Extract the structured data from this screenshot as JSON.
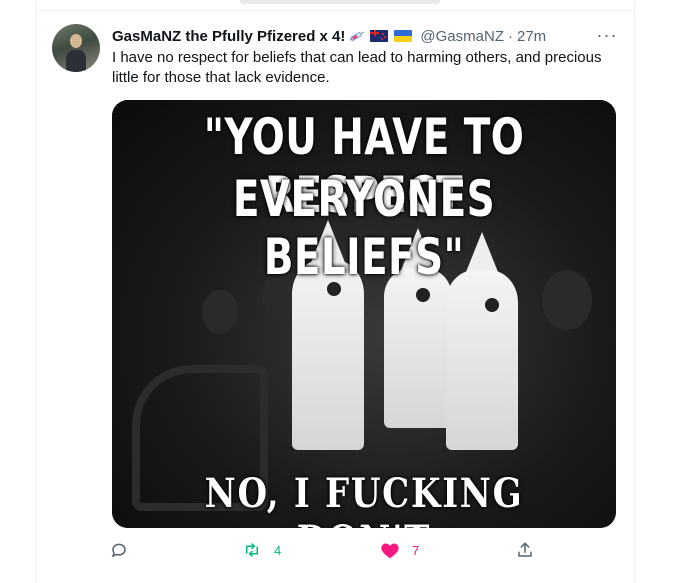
{
  "tweet": {
    "display_name": "GasMaNZ the Pfully Pfizered x 4!",
    "handle": "@GasmaNZ",
    "separator": "·",
    "time": "27m",
    "more_label": "···",
    "text": "I have no respect for beliefs that can lead to harming others, and precious little for those that lack evidence.",
    "name_emojis": [
      "syringe-icon",
      "new-zealand-flag-icon",
      "ukraine-flag-icon"
    ]
  },
  "media": {
    "top_text_line1": "\"YOU HAVE TO RESPECT",
    "top_text_line2": "EVERYONES BELIEFS\"",
    "bottom_text": "NO, I FUCKING DON'T"
  },
  "actions": {
    "reply_count": "",
    "retweet_count": "4",
    "like_count": "7",
    "retweet_color": "#00ba7c",
    "like_color": "#f91880",
    "icon_color": "#536471"
  }
}
